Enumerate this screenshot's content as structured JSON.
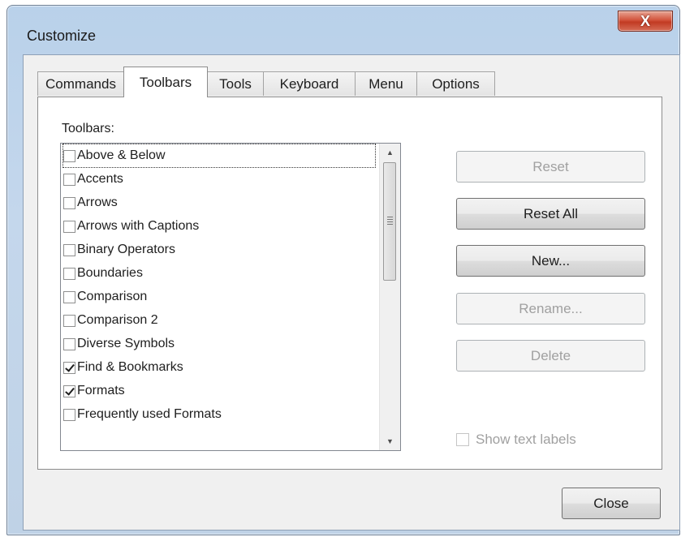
{
  "window": {
    "title": "Customize",
    "close_glyph": "X"
  },
  "tabs": [
    {
      "label": "Commands",
      "active": false
    },
    {
      "label": "Toolbars",
      "active": true
    },
    {
      "label": "Tools",
      "active": false
    },
    {
      "label": "Keyboard",
      "active": false
    },
    {
      "label": "Menu",
      "active": false
    },
    {
      "label": "Options",
      "active": false
    }
  ],
  "toolbars_panel": {
    "group_label": "Toolbars:",
    "items": [
      {
        "label": "Above & Below",
        "checked": false
      },
      {
        "label": "Accents",
        "checked": false
      },
      {
        "label": "Arrows",
        "checked": false
      },
      {
        "label": "Arrows with Captions",
        "checked": false
      },
      {
        "label": "Binary Operators",
        "checked": false
      },
      {
        "label": "Boundaries",
        "checked": false
      },
      {
        "label": "Comparison",
        "checked": false
      },
      {
        "label": "Comparison 2",
        "checked": false
      },
      {
        "label": "Diverse Symbols",
        "checked": false
      },
      {
        "label": "Find & Bookmarks",
        "checked": true
      },
      {
        "label": "Formats",
        "checked": true
      },
      {
        "label": "Frequently used Formats",
        "checked": false
      }
    ],
    "buttons": {
      "reset": "Reset",
      "reset_all": "Reset All",
      "new": "New...",
      "rename": "Rename...",
      "delete": "Delete"
    },
    "show_text_labels": {
      "label": "Show text labels",
      "checked": false
    }
  },
  "footer": {
    "close": "Close"
  }
}
